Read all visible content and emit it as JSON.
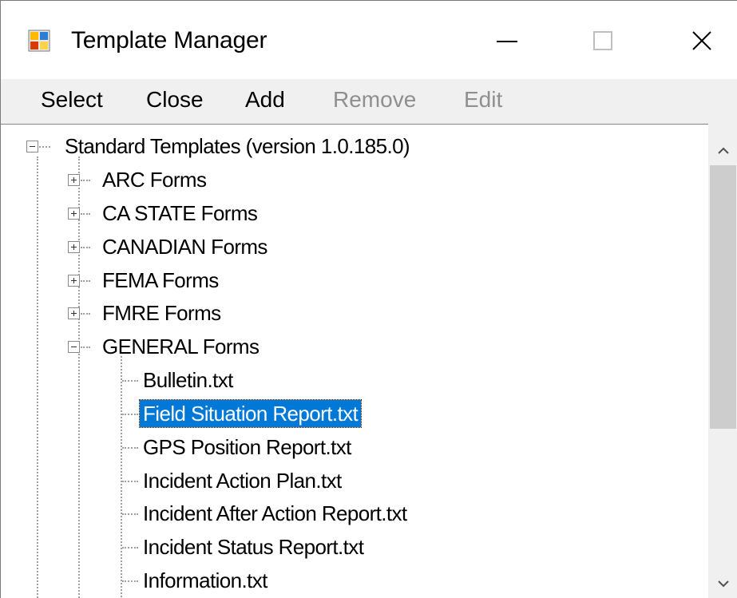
{
  "window": {
    "title": "Template Manager",
    "icon": "app-window-icon",
    "controls": [
      "minimize-icon",
      "maximize-icon",
      "close-icon"
    ]
  },
  "menu": {
    "select": "Select",
    "close": "Close",
    "add": "Add",
    "remove": "Remove",
    "edit": "Edit"
  },
  "tree": {
    "root": "Standard Templates (version 1.0.185.0)",
    "folders": {
      "arc": "ARC Forms",
      "ca_state": "CA STATE Forms",
      "canadian": "CANADIAN Forms",
      "fema": "FEMA Forms",
      "fmre": "FMRE Forms",
      "general": "GENERAL Forms"
    },
    "files": {
      "bulletin": "Bulletin.txt",
      "field_situation": "Field Situation Report.txt",
      "gps_position": "GPS Position Report.txt",
      "incident_action": "Incident Action Plan.txt",
      "incident_after": "Incident After Action Report.txt",
      "incident_status": "Incident Status Report.txt",
      "information": "Information.txt"
    },
    "selected": "Field Situation Report.txt"
  },
  "colors": {
    "selection": "#0078d7",
    "disabled_text": "#8f8f8f",
    "scroll_thumb": "#cdcdcd"
  }
}
